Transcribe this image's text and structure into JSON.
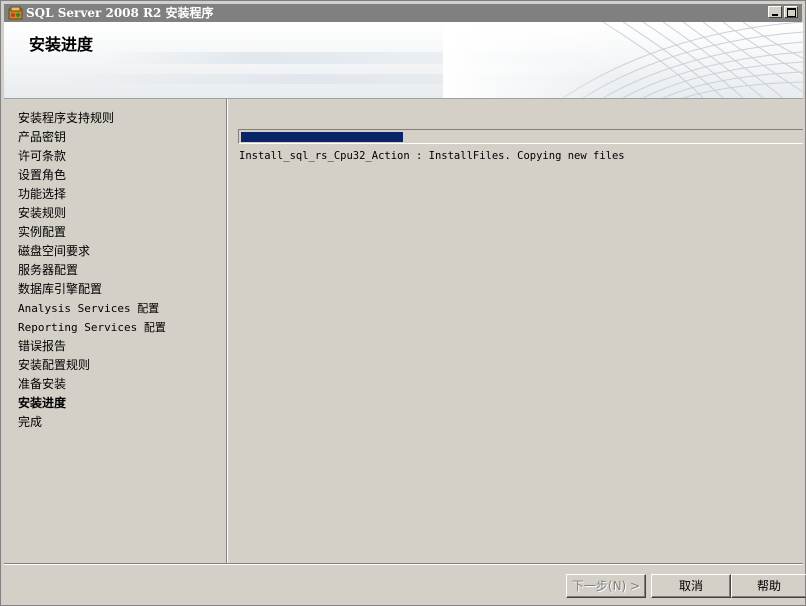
{
  "window": {
    "title": "SQL Server 2008 R2 安装程序"
  },
  "header": {
    "title": "安装进度"
  },
  "nav": {
    "items": [
      {
        "label": "安装程序支持规则",
        "current": false
      },
      {
        "label": "产品密钥",
        "current": false
      },
      {
        "label": "许可条款",
        "current": false
      },
      {
        "label": "设置角色",
        "current": false
      },
      {
        "label": "功能选择",
        "current": false
      },
      {
        "label": "安装规则",
        "current": false
      },
      {
        "label": "实例配置",
        "current": false
      },
      {
        "label": "磁盘空间要求",
        "current": false
      },
      {
        "label": "服务器配置",
        "current": false
      },
      {
        "label": "数据库引擎配置",
        "current": false
      },
      {
        "label": "Analysis Services 配置",
        "current": false
      },
      {
        "label": "Reporting Services 配置",
        "current": false
      },
      {
        "label": "错误报告",
        "current": false
      },
      {
        "label": "安装配置规则",
        "current": false
      },
      {
        "label": "准备安装",
        "current": false
      },
      {
        "label": "安装进度",
        "current": true
      },
      {
        "label": "完成",
        "current": false
      }
    ]
  },
  "progress": {
    "fraction": 0.29,
    "fill_color": "#0a246a",
    "status": "Install_sql_rs_Cpu32_Action : InstallFiles. Copying new files"
  },
  "buttons": {
    "next": "下一步(N) >",
    "cancel": "取消",
    "help": "帮助"
  }
}
